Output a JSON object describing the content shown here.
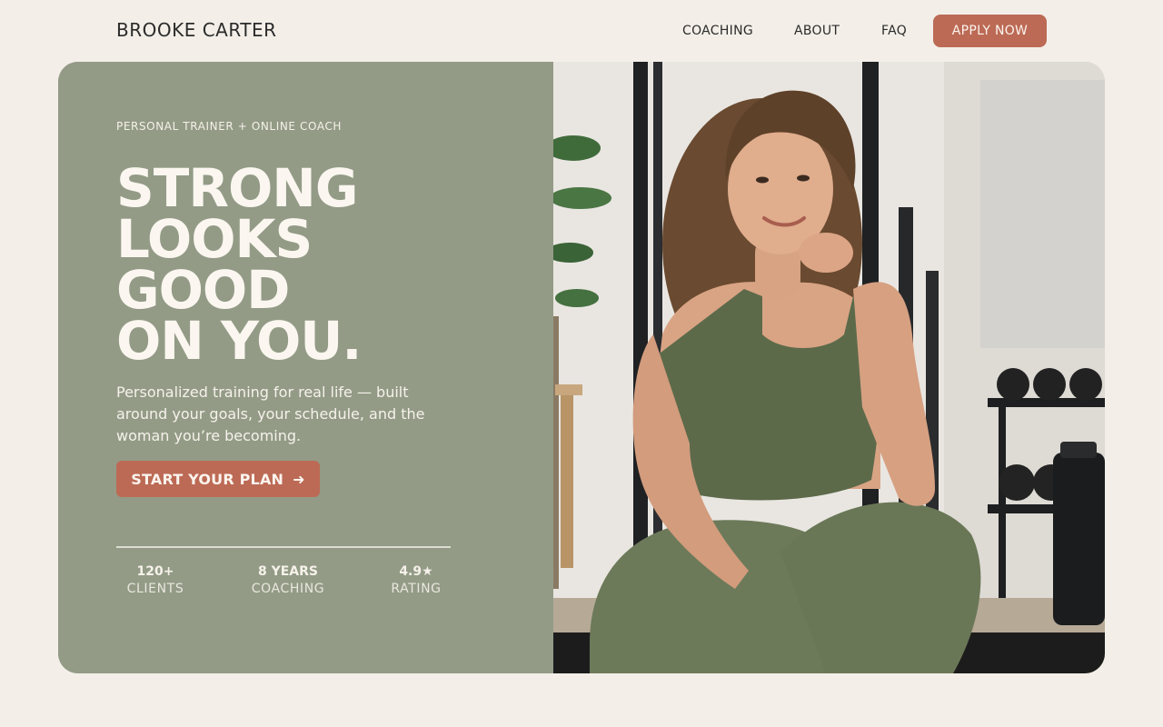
{
  "nav": {
    "brand": "BROOKE CARTER",
    "links": [
      "COACHING",
      "ABOUT",
      "FAQ"
    ],
    "apply_label": "APPLY NOW"
  },
  "hero": {
    "eyebrow": "PERSONAL TRAINER + ONLINE COACH",
    "headline_lines": [
      "STRONG",
      "LOOKS",
      "GOOD",
      "ON YOU."
    ],
    "subcopy": "Personalized training for real life — built around your goals, your schedule, and the woman you’re becoming.",
    "cta_label": "START YOUR PLAN",
    "cta_icon": "arrow-right-icon",
    "stats": [
      {
        "value": "120+",
        "label": "CLIENTS"
      },
      {
        "value": "8 YEARS",
        "label": "COACHING"
      },
      {
        "value": "4.9★",
        "label": "RATING"
      }
    ],
    "image_subject": "trainer-portrait-photo"
  },
  "colors": {
    "background": "#f3efe8",
    "sage_panel": "#939b87",
    "accent": "#bc6a55",
    "text_dark": "#2b2b2b",
    "text_light": "#fbf7f0"
  }
}
